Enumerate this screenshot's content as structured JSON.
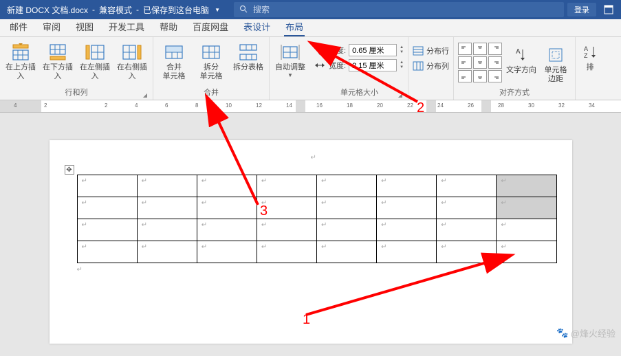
{
  "titlebar": {
    "filename": "新建 DOCX 文档.docx",
    "compat": "兼容模式",
    "saved": "已保存到这台电脑",
    "search_placeholder": "搜索",
    "login": "登录"
  },
  "tabs": {
    "mail": "邮件",
    "review": "审阅",
    "view": "视图",
    "devtools": "开发工具",
    "help": "帮助",
    "baidu": "百度网盘",
    "table_design": "表设计",
    "layout": "布局"
  },
  "ribbon": {
    "rows_cols": {
      "insert_above": "在上方插入",
      "insert_below": "在下方插入",
      "insert_left": "在左侧插入",
      "insert_right": "在右侧插入",
      "label": "行和列"
    },
    "merge": {
      "merge_cells": "合并\n单元格",
      "split_cells": "拆分\n单元格",
      "split_table": "拆分表格",
      "label": "合并"
    },
    "autofit": {
      "autofit": "自动调整",
      "label": ""
    },
    "size": {
      "height_label": "高度:",
      "height_val": "0.65 厘米",
      "width_label": "宽度:",
      "width_val": "2.15 厘米",
      "label": "单元格大小"
    },
    "distribute": {
      "rows": "分布行",
      "cols": "分布列"
    },
    "align": {
      "text_dir": "文字方向",
      "cell_margin": "单元格\n边距",
      "label": "对齐方式"
    },
    "sort": {
      "sort": "排"
    }
  },
  "ruler": {
    "marks": [
      "4",
      "2",
      "",
      "2",
      "4",
      "6",
      "8",
      "10",
      "12",
      "14",
      "16",
      "18",
      "20",
      "22",
      "24",
      "26",
      "28",
      "30",
      "32",
      "34"
    ]
  },
  "annotations": {
    "n1": "1",
    "n2": "2",
    "n3": "3"
  },
  "watermark": "@烽火经验"
}
